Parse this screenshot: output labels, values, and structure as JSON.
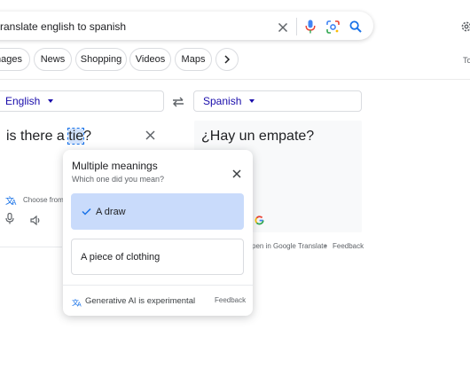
{
  "search": {
    "query": "ranslate english to spanish"
  },
  "chips": [
    "nages",
    "News",
    "Shopping",
    "Videos",
    "Maps"
  ],
  "right_edge_text": "To",
  "translator": {
    "source_language": "English",
    "target_language": "Spanish",
    "source_text_before": "is there a ",
    "source_text_highlight": "tie",
    "source_text_after": "?",
    "target_text": "¿Hay un empate?",
    "choose_from": "Choose from",
    "open_link": "pen in Google Translate",
    "dot": "•",
    "feedback": "Feedback"
  },
  "popup": {
    "title": "Multiple meanings",
    "subtitle": "Which one did you mean?",
    "options": [
      {
        "label": "A draw",
        "selected": true
      },
      {
        "label": "A piece of clothing",
        "selected": false
      }
    ],
    "footer": "Generative AI is experimental",
    "feedback": "Feedback"
  },
  "colors": {
    "accent": "#1a73e8",
    "link": "#1a0dab",
    "selected_option": "#c9dbfb"
  }
}
